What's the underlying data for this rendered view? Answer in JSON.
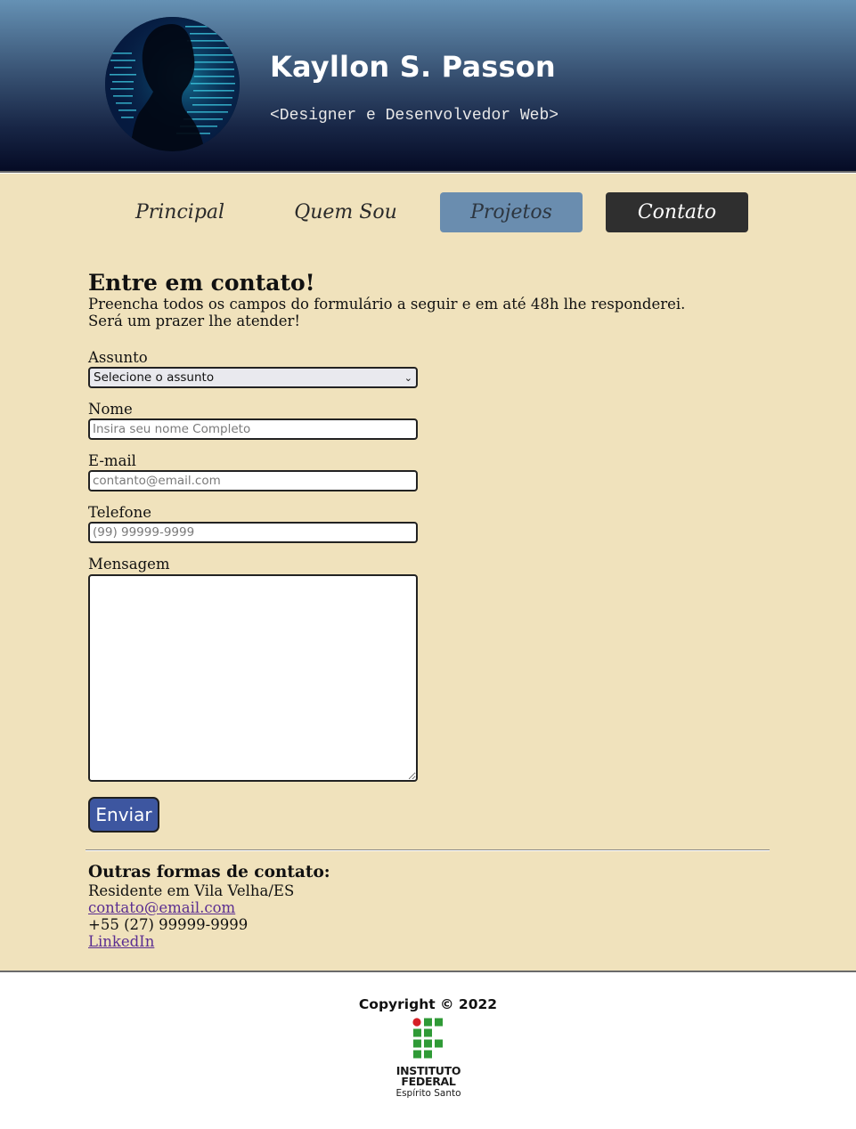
{
  "header": {
    "title": "Kayllon S. Passon",
    "subtitle": "<Designer e Desenvolvedor Web>",
    "avatar_icon": "code-portrait-avatar"
  },
  "nav": {
    "items": [
      {
        "label": "Principal",
        "state": "default"
      },
      {
        "label": "Quem Sou",
        "state": "default"
      },
      {
        "label": "Projetos",
        "state": "hover"
      },
      {
        "label": "Contato",
        "state": "active"
      }
    ]
  },
  "contact": {
    "title": "Entre em contato!",
    "desc_line1": "Preencha todos os campos do formulário a seguir e em até 48h lhe responderei.",
    "desc_line2": "Será um prazer lhe atender!",
    "form": {
      "subject_label": "Assunto",
      "subject_selected": "Selecione o assunto",
      "name_label": "Nome",
      "name_placeholder": "Insira seu nome Completo",
      "email_label": "E-mail",
      "email_placeholder": "contanto@email.com",
      "phone_label": "Telefone",
      "phone_placeholder": "(99) 99999-9999",
      "message_label": "Mensagem",
      "message_value": "",
      "submit_label": "Enviar"
    }
  },
  "other": {
    "title": "Outras formas de contato:",
    "location": "Residente em Vila Velha/ES",
    "email": "contato@email.com",
    "phone": "+55 (27) 99999-9999",
    "linkedin": "LinkedIn"
  },
  "footer": {
    "copyright": "Copyright © 2022",
    "logo_line1": "INSTITUTO",
    "logo_line2": "FEDERAL",
    "logo_line3": "Espírito Santo"
  },
  "colors": {
    "header_top": "#6591b4",
    "header_bottom": "#050b25",
    "page_bg": "#f0e2bc",
    "nav_hover": "#6a8daf",
    "nav_active": "#2f2f2f",
    "button": "#3d56a0",
    "if_green": "#2f9a36",
    "if_red": "#d51f26"
  }
}
